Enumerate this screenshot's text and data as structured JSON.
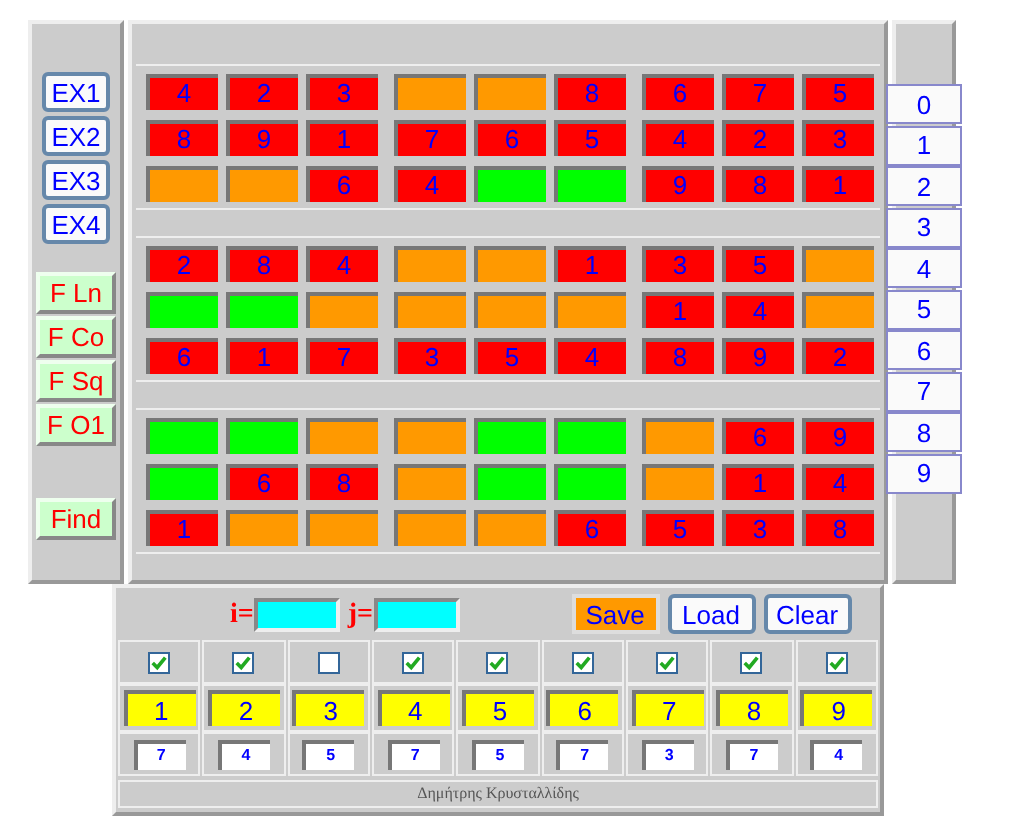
{
  "example_buttons": [
    "EX1",
    "EX2",
    "EX3",
    "EX4"
  ],
  "function_buttons": [
    "F Ln",
    "F Co",
    "F Sq",
    "F O1"
  ],
  "find_button": "Find",
  "grid": [
    [
      {
        "value": "4",
        "color": "#ff0000"
      },
      {
        "value": "2",
        "color": "#ff0000"
      },
      {
        "value": "3",
        "color": "#ff0000"
      },
      {
        "color": "#ff9900"
      },
      {
        "color": "#ff9900"
      },
      {
        "value": "8",
        "color": "#ff0000"
      },
      {
        "value": "6",
        "color": "#ff0000"
      },
      {
        "value": "7",
        "color": "#ff0000"
      },
      {
        "value": "5",
        "color": "#ff0000"
      }
    ],
    [
      {
        "value": "8",
        "color": "#ff0000"
      },
      {
        "value": "9",
        "color": "#ff0000"
      },
      {
        "value": "1",
        "color": "#ff0000"
      },
      {
        "value": "7",
        "color": "#ff0000"
      },
      {
        "value": "6",
        "color": "#ff0000"
      },
      {
        "value": "5",
        "color": "#ff0000"
      },
      {
        "value": "4",
        "color": "#ff0000"
      },
      {
        "value": "2",
        "color": "#ff0000"
      },
      {
        "value": "3",
        "color": "#ff0000"
      }
    ],
    [
      {
        "color": "#ff9900"
      },
      {
        "color": "#ff9900"
      },
      {
        "value": "6",
        "color": "#ff0000"
      },
      {
        "value": "4",
        "color": "#ff0000"
      },
      {
        "color": "#00ff00"
      },
      {
        "color": "#00ff00"
      },
      {
        "value": "9",
        "color": "#ff0000"
      },
      {
        "value": "8",
        "color": "#ff0000"
      },
      {
        "value": "1",
        "color": "#ff0000"
      }
    ],
    [
      {
        "value": "2",
        "color": "#ff0000"
      },
      {
        "value": "8",
        "color": "#ff0000"
      },
      {
        "value": "4",
        "color": "#ff0000"
      },
      {
        "color": "#ff9900"
      },
      {
        "color": "#ff9900"
      },
      {
        "value": "1",
        "color": "#ff0000"
      },
      {
        "value": "3",
        "color": "#ff0000"
      },
      {
        "value": "5",
        "color": "#ff0000"
      },
      {
        "color": "#ff9900"
      }
    ],
    [
      {
        "color": "#00ff00"
      },
      {
        "color": "#00ff00"
      },
      {
        "color": "#ff9900"
      },
      {
        "color": "#ff9900"
      },
      {
        "color": "#ff9900"
      },
      {
        "color": "#ff9900"
      },
      {
        "value": "1",
        "color": "#ff0000"
      },
      {
        "value": "4",
        "color": "#ff0000"
      },
      {
        "color": "#ff9900"
      }
    ],
    [
      {
        "value": "6",
        "color": "#ff0000"
      },
      {
        "value": "1",
        "color": "#ff0000"
      },
      {
        "value": "7",
        "color": "#ff0000"
      },
      {
        "value": "3",
        "color": "#ff0000"
      },
      {
        "value": "5",
        "color": "#ff0000"
      },
      {
        "value": "4",
        "color": "#ff0000"
      },
      {
        "value": "8",
        "color": "#ff0000"
      },
      {
        "value": "9",
        "color": "#ff0000"
      },
      {
        "value": "2",
        "color": "#ff0000"
      }
    ],
    [
      {
        "color": "#00ff00"
      },
      {
        "color": "#00ff00"
      },
      {
        "color": "#ff9900"
      },
      {
        "color": "#ff9900"
      },
      {
        "color": "#00ff00"
      },
      {
        "color": "#00ff00"
      },
      {
        "color": "#ff9900"
      },
      {
        "value": "6",
        "color": "#ff0000"
      },
      {
        "value": "9",
        "color": "#ff0000"
      }
    ],
    [
      {
        "color": "#00ff00"
      },
      {
        "value": "6",
        "color": "#ff0000"
      },
      {
        "value": "8",
        "color": "#ff0000"
      },
      {
        "color": "#ff9900"
      },
      {
        "color": "#00ff00"
      },
      {
        "color": "#00ff00"
      },
      {
        "color": "#ff9900"
      },
      {
        "value": "1",
        "color": "#ff0000"
      },
      {
        "value": "4",
        "color": "#ff0000"
      }
    ],
    [
      {
        "value": "1",
        "color": "#ff0000"
      },
      {
        "color": "#ff9900"
      },
      {
        "color": "#ff9900"
      },
      {
        "color": "#ff9900"
      },
      {
        "color": "#ff9900"
      },
      {
        "value": "6",
        "color": "#ff0000"
      },
      {
        "value": "5",
        "color": "#ff0000"
      },
      {
        "value": "3",
        "color": "#ff0000"
      },
      {
        "value": "8",
        "color": "#ff0000"
      }
    ]
  ],
  "digit_buttons": [
    "0",
    "1",
    "2",
    "3",
    "4",
    "5",
    "6",
    "7",
    "8",
    "9"
  ],
  "i_field": {
    "label": "i="
  },
  "j_field": {
    "label": "j="
  },
  "actions": [
    {
      "label": "Save",
      "selected": true
    },
    {
      "label": "Load",
      "selected": false
    },
    {
      "label": "Clear",
      "selected": false
    }
  ],
  "columns": [
    {
      "checked": true,
      "number": "1",
      "count": "7"
    },
    {
      "checked": true,
      "number": "2",
      "count": "4"
    },
    {
      "checked": false,
      "number": "3",
      "count": "5"
    },
    {
      "checked": true,
      "number": "4",
      "count": "7"
    },
    {
      "checked": true,
      "number": "5",
      "count": "5"
    },
    {
      "checked": true,
      "number": "6",
      "count": "7"
    },
    {
      "checked": true,
      "number": "7",
      "count": "3"
    },
    {
      "checked": true,
      "number": "8",
      "count": "7"
    },
    {
      "checked": true,
      "number": "9",
      "count": "4"
    }
  ],
  "footer": "Δημήτρης Κρυσταλλίδης"
}
